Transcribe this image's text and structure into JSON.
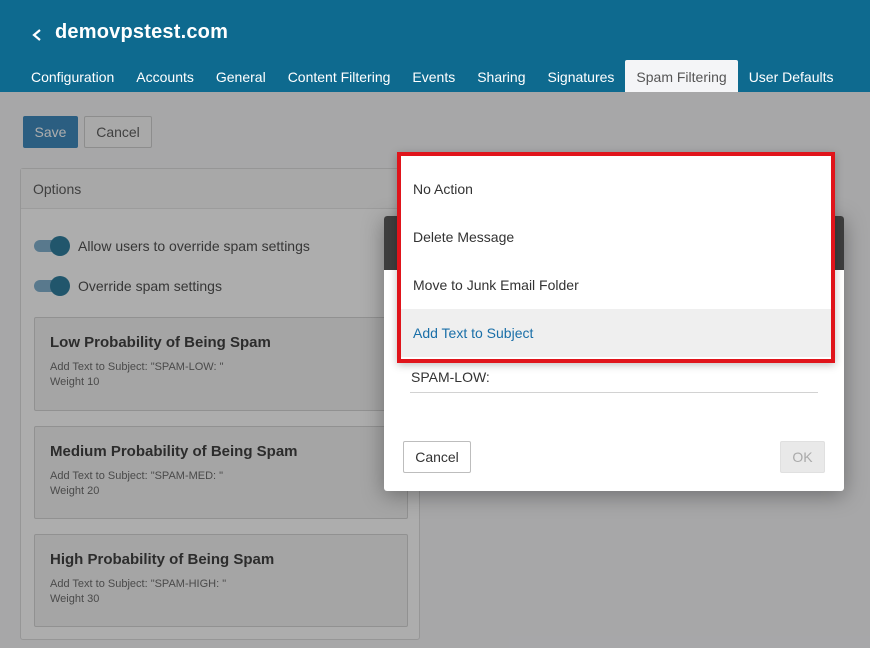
{
  "header": {
    "title": "demovpstest.com",
    "back_icon": "chevron-left-icon",
    "tabs": [
      {
        "label": "Configuration"
      },
      {
        "label": "Accounts"
      },
      {
        "label": "General"
      },
      {
        "label": "Content Filtering"
      },
      {
        "label": "Events"
      },
      {
        "label": "Sharing"
      },
      {
        "label": "Signatures"
      },
      {
        "label": "Spam Filtering",
        "active": true
      },
      {
        "label": "User Defaults"
      }
    ],
    "color": "#0e6a8f"
  },
  "toolbar": {
    "save_label": "Save",
    "cancel_label": "Cancel"
  },
  "options": {
    "title": "Options",
    "toggles": [
      {
        "label": "Allow users to override spam settings",
        "on": true
      },
      {
        "label": "Override spam settings",
        "on": true
      }
    ],
    "cards": [
      {
        "title": "Low Probability of Being Spam",
        "action": "Add Text to Subject: \"SPAM-LOW: \"",
        "weight": "Weight 10"
      },
      {
        "title": "Medium Probability of Being Spam",
        "action": "Add Text to Subject: \"SPAM-MED: \"",
        "weight": "Weight 20"
      },
      {
        "title": "High Probability of Being Spam",
        "action": "Add Text to Subject: \"SPAM-HIGH: \"",
        "weight": "Weight 30"
      }
    ]
  },
  "dialog": {
    "text_value": "SPAM-LOW:",
    "cancel_label": "Cancel",
    "ok_label": "OK"
  },
  "dropdown": {
    "options": [
      {
        "label": "No Action"
      },
      {
        "label": "Delete Message"
      },
      {
        "label": "Move to Junk Email Folder"
      },
      {
        "label": "Add Text to Subject",
        "selected": true
      }
    ],
    "highlight_color": "#e0141b"
  }
}
